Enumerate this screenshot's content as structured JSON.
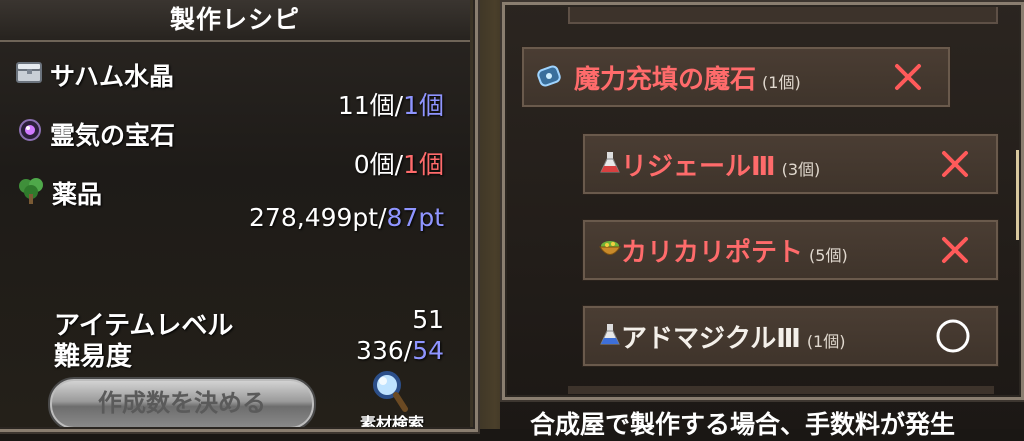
{
  "left_panel": {
    "title": "製作レシピ",
    "materials": [
      {
        "icon": "crystal-chest-icon",
        "name": "サハム水晶",
        "have": "11個/",
        "need": "1個",
        "need_color": "blue"
      },
      {
        "icon": "purple-gem-icon",
        "name": "霊気の宝石",
        "have": "0個/",
        "need": "1個",
        "need_color": "red"
      },
      {
        "icon": "herb-tree-icon",
        "name": "薬品",
        "have": "278,499pt/",
        "need": "87pt",
        "need_color": "blue"
      }
    ],
    "item_level_label": "アイテムレベル",
    "item_level_value": "51",
    "difficulty_label": "難易度",
    "difficulty_have": "336/",
    "difficulty_need": "54",
    "decide_button": "作成数を決める",
    "search_label": "素材検索"
  },
  "right_panel": {
    "items": [
      {
        "icon": "magic-stone-icon",
        "name": "魔力充填の魔石",
        "count": "(1個)",
        "status": "x",
        "name_color": "red"
      },
      {
        "icon": "potion-flask-icon",
        "name": "リジェールⅢ",
        "count": "(3個)",
        "status": "x",
        "name_color": "red"
      },
      {
        "icon": "pot-food-icon",
        "name": "カリカリポテト",
        "count": "(5個)",
        "status": "x",
        "name_color": "red"
      },
      {
        "icon": "potion-flask-icon",
        "name": "アドマジクルⅢ",
        "count": "(1個)",
        "status": "o",
        "name_color": "white"
      }
    ],
    "notice": "合成屋で製作する場合、手数料が発生"
  },
  "colors": {
    "blue": "#8f95ff",
    "red": "#ff6b6b",
    "x_mark": "#ff5a5a"
  }
}
